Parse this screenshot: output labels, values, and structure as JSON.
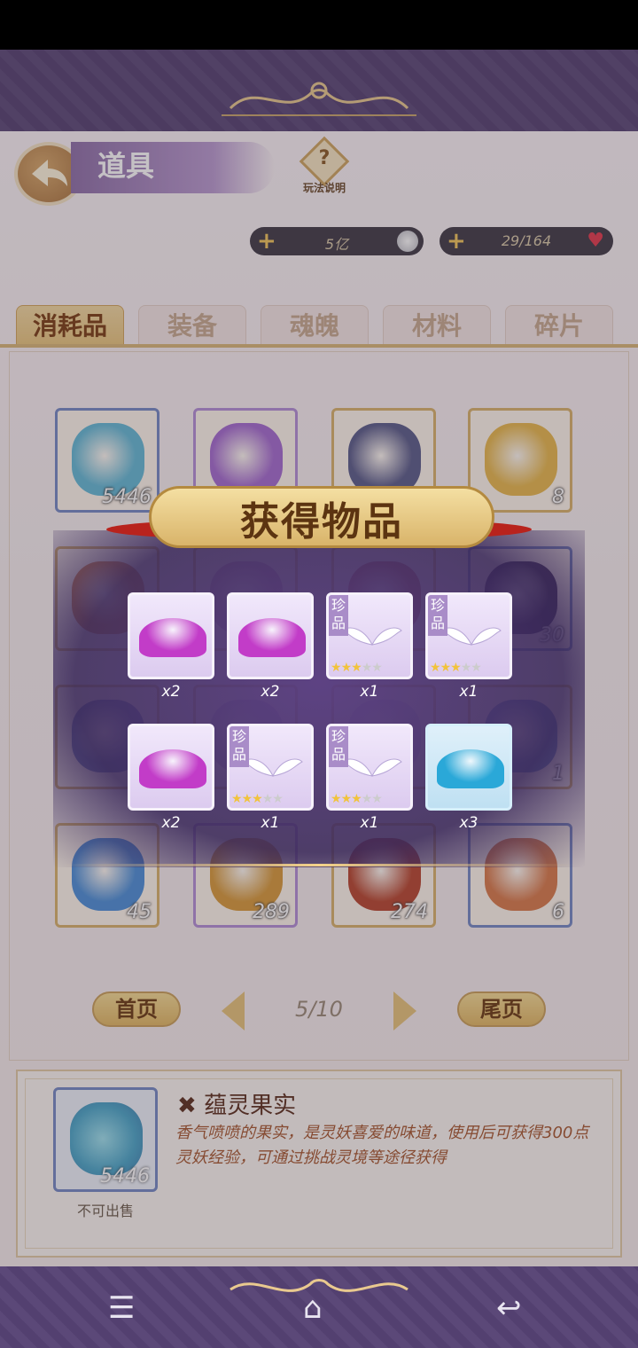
{
  "header": {
    "title": "道具",
    "help_label": "玩法说明",
    "help_icon": "?"
  },
  "resources": [
    {
      "value": "5亿",
      "icon": "silver-coin-icon"
    },
    {
      "value": "29/164",
      "icon": "heart-icon"
    }
  ],
  "tabs": [
    {
      "label": "消耗品",
      "active": true
    },
    {
      "label": "装备",
      "active": false
    },
    {
      "label": "魂魄",
      "active": false
    },
    {
      "label": "材料",
      "active": false
    },
    {
      "label": "碎片",
      "active": false
    }
  ],
  "grid": {
    "items": [
      {
        "count": "5446",
        "frame": "blue",
        "color": "#63b9d6"
      },
      {
        "count": "",
        "frame": "purple",
        "color": "#a46ad0"
      },
      {
        "count": "",
        "frame": "gold",
        "color": "#5a5c8a"
      },
      {
        "count": "8",
        "frame": "gold",
        "color": "#e8b84c"
      },
      {
        "count": "",
        "frame": "gold",
        "color": "#d98a54"
      },
      {
        "count": "",
        "frame": "gold",
        "color": "#cfa0c8"
      },
      {
        "count": "",
        "frame": "gold",
        "color": "#c86a6a"
      },
      {
        "count": "30",
        "frame": "blue",
        "color": "#3d2f55"
      },
      {
        "count": "",
        "frame": "gold",
        "color": "#6f7fb8"
      },
      {
        "count": "",
        "frame": "gold",
        "color": "#c7b7d8"
      },
      {
        "count": "",
        "frame": "gold",
        "color": "#d8c8e8"
      },
      {
        "count": "1",
        "frame": "gold",
        "color": "#6a88c4"
      },
      {
        "count": "45",
        "frame": "gold",
        "color": "#4c8fd8"
      },
      {
        "count": "289",
        "frame": "purple",
        "color": "#d89a3a"
      },
      {
        "count": "274",
        "frame": "gold",
        "color": "#b8462e"
      },
      {
        "count": "6",
        "frame": "blue",
        "color": "#d97a4a"
      }
    ]
  },
  "pager": {
    "first": "首页",
    "last": "尾页",
    "page": "5/10"
  },
  "detail": {
    "name": "蕴灵果实",
    "count": "5446",
    "sell_status": "不可出售",
    "description": "香气喷喷的果实，是灵妖喜爱的味道，使用后可获得300点灵妖经验，可通过挑战灵境等途径获得"
  },
  "reward_popup": {
    "title": "获得物品",
    "items": [
      {
        "kind": "pile",
        "color": "#c23cc8",
        "count": "x2",
        "rare_tag": "",
        "stars": 0
      },
      {
        "kind": "pile",
        "color": "#c23cc8",
        "count": "x2",
        "rare_tag": "",
        "stars": 0
      },
      {
        "kind": "wing",
        "color": "#ffffff",
        "count": "x1",
        "rare_tag": "珍品",
        "stars": 3
      },
      {
        "kind": "wing",
        "color": "#ffffff",
        "count": "x1",
        "rare_tag": "珍品",
        "stars": 3
      },
      {
        "kind": "pile",
        "color": "#c23cc8",
        "count": "x2",
        "rare_tag": "",
        "stars": 0
      },
      {
        "kind": "wing",
        "color": "#ffffff",
        "count": "x1",
        "rare_tag": "珍品",
        "stars": 3
      },
      {
        "kind": "wing",
        "color": "#ffffff",
        "count": "x1",
        "rare_tag": "珍品",
        "stars": 3
      },
      {
        "kind": "pile",
        "color": "#2aa8d8",
        "count": "x3",
        "rare_tag": "",
        "stars": 0
      }
    ]
  },
  "nav": {
    "menu_icon": "☰",
    "home_icon": "⌂",
    "back_icon": "↩"
  }
}
